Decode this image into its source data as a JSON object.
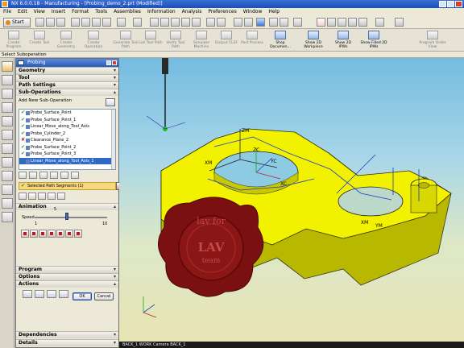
{
  "window": {
    "title": "NX 6.0.0.18 - Manufacturing - [Probing_demo_2.prt (Modified)]"
  },
  "menu": [
    "File",
    "Edit",
    "View",
    "Insert",
    "Format",
    "Tools",
    "Assemblies",
    "Information",
    "Analysis",
    "Preferences",
    "Window",
    "Help"
  ],
  "toolbar": {
    "start_label": "Start",
    "items": [
      {
        "label": "Create Program",
        "enabled": false
      },
      {
        "label": "Create Tool",
        "enabled": false
      },
      {
        "label": "Create Geometry",
        "enabled": false
      },
      {
        "label": "Create Operation",
        "enabled": false
      },
      {
        "label": "Generate Tool Path",
        "enabled": false
      },
      {
        "label": "List Tool Path",
        "enabled": false
      },
      {
        "label": "Verify Tool Path",
        "enabled": false
      },
      {
        "label": "Simulate Machine",
        "enabled": false
      },
      {
        "label": "Output CLSF",
        "enabled": false
      },
      {
        "label": "Post Process",
        "enabled": false
      },
      {
        "label": "Shop Documen...",
        "enabled": true
      },
      {
        "label": "Show 2D Workpiece",
        "enabled": true
      },
      {
        "label": "Show 2D IPWs",
        "enabled": true
      },
      {
        "label": "Show Filled 2D IPWs",
        "enabled": true
      },
      {
        "label": "Program Order View",
        "enabled": false
      }
    ]
  },
  "subheader": "Select Suboperation",
  "dialog": {
    "title": "Probing",
    "sections": {
      "geometry": "Geometry",
      "tool": "Tool",
      "path_settings": "Path Settings",
      "sub_operations": "Sub-Operations",
      "program": "Program",
      "options": "Options",
      "actions": "Actions",
      "dependencies": "Dependencies",
      "details": "Details"
    },
    "add_new_label": "Add New Sub-Operation",
    "operations": [
      {
        "name": "Probe_Surface_Point",
        "status": "ok",
        "selected": false
      },
      {
        "name": "Probe_Surface_Point_1",
        "status": "ok",
        "selected": false
      },
      {
        "name": "Linear_Move_along_Tool_Axis",
        "status": "ok",
        "selected": false
      },
      {
        "name": "Probe_Cylinder_2",
        "status": "ok",
        "selected": false
      },
      {
        "name": "Clearance_Plane_2",
        "status": "bad",
        "selected": false
      },
      {
        "name": "Probe_Surface_Point_2",
        "status": "ok",
        "selected": false
      },
      {
        "name": "Probe_Surface_Point_3",
        "status": "ok",
        "selected": false
      },
      {
        "name": "Linear_Move_along_Tool_Axis_1",
        "status": "ok",
        "selected": true
      }
    ],
    "selected_segments": "Selected Path Segments (1)",
    "animation": {
      "label": "Animation",
      "speed_label": "Speed",
      "speed_value": "5",
      "speed_min": "1",
      "speed_max": "10",
      "speed_fraction": 0.44
    },
    "ok_label": "OK",
    "cancel_label": "Cancel"
  },
  "viewport": {
    "status_text": "BACK_1 WORK Camera BACK_1",
    "axis_labels": {
      "zm": "ZM",
      "xm": "XM",
      "zc": "ZC",
      "yc": "YC",
      "xc": "XC",
      "xm2": "XM",
      "ym": "YM"
    },
    "seal_top": "lav for",
    "seal_center": "LAV",
    "seal_bottom": "team"
  },
  "colors": {
    "part": "#f2f200",
    "part_edge": "#2a2a00",
    "seal": "#7a1010"
  }
}
